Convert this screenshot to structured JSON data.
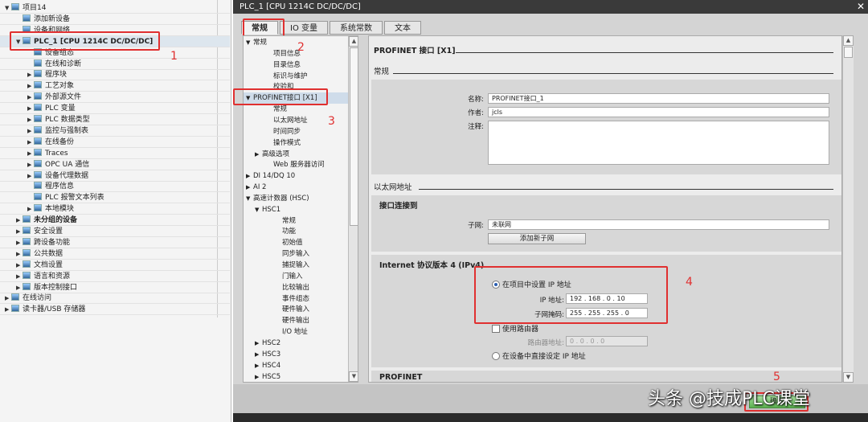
{
  "project_tree": {
    "items": [
      {
        "label": "项目14",
        "level": 0,
        "arrow": "▼"
      },
      {
        "label": "添加新设备",
        "level": 1,
        "arrow": ""
      },
      {
        "label": "设备和网络",
        "level": 1,
        "arrow": ""
      },
      {
        "label": "PLC_1 [CPU 1214C DC/DC/DC]",
        "level": 1,
        "arrow": "▼",
        "bold": true
      },
      {
        "label": "设备组态",
        "level": 2,
        "arrow": ""
      },
      {
        "label": "在线和诊断",
        "level": 2,
        "arrow": ""
      },
      {
        "label": "程序块",
        "level": 2,
        "arrow": "▶"
      },
      {
        "label": "工艺对象",
        "level": 2,
        "arrow": "▶"
      },
      {
        "label": "外部源文件",
        "level": 2,
        "arrow": "▶"
      },
      {
        "label": "PLC 变量",
        "level": 2,
        "arrow": "▶"
      },
      {
        "label": "PLC 数据类型",
        "level": 2,
        "arrow": "▶"
      },
      {
        "label": "监控与强制表",
        "level": 2,
        "arrow": "▶"
      },
      {
        "label": "在线备份",
        "level": 2,
        "arrow": "▶"
      },
      {
        "label": "Traces",
        "level": 2,
        "arrow": "▶"
      },
      {
        "label": "OPC UA 通信",
        "level": 2,
        "arrow": "▶"
      },
      {
        "label": "设备代理数据",
        "level": 2,
        "arrow": "▶"
      },
      {
        "label": "程序信息",
        "level": 2,
        "arrow": ""
      },
      {
        "label": "PLC 报警文本列表",
        "level": 2,
        "arrow": ""
      },
      {
        "label": "本地模块",
        "level": 2,
        "arrow": "▶"
      },
      {
        "label": "未分组的设备",
        "level": 1,
        "arrow": "▶",
        "bold": true
      },
      {
        "label": "安全设置",
        "level": 1,
        "arrow": "▶"
      },
      {
        "label": "跨设备功能",
        "level": 1,
        "arrow": "▶"
      },
      {
        "label": "公共数据",
        "level": 1,
        "arrow": "▶"
      },
      {
        "label": "文档设置",
        "level": 1,
        "arrow": "▶"
      },
      {
        "label": "语言和资源",
        "level": 1,
        "arrow": "▶"
      },
      {
        "label": "版本控制接口",
        "level": 1,
        "arrow": "▶"
      },
      {
        "label": "在线访问",
        "level": 0,
        "arrow": "▶"
      },
      {
        "label": "读卡器/USB 存储器",
        "level": 0,
        "arrow": "▶"
      }
    ]
  },
  "annotations": [
    "1",
    "2",
    "3",
    "4",
    "5"
  ],
  "dialog": {
    "title": "PLC_1 [CPU 1214C DC/DC/DC]",
    "close": "✕",
    "tabs": [
      "常规",
      "IO 变量",
      "系统常数",
      "文本"
    ],
    "nav": [
      {
        "label": "常规",
        "level": 0,
        "arrow": "▼"
      },
      {
        "label": "项目信息",
        "level": 1,
        "arrow": ""
      },
      {
        "label": "目录信息",
        "level": 1,
        "arrow": ""
      },
      {
        "label": "标识与维护",
        "level": 1,
        "arrow": ""
      },
      {
        "label": "校验和",
        "level": 1,
        "arrow": ""
      },
      {
        "label": "PROFINET接口 [X1]",
        "level": 0,
        "arrow": "▼",
        "sel": true
      },
      {
        "label": "常规",
        "level": 1,
        "arrow": ""
      },
      {
        "label": "以太网地址",
        "level": 1,
        "arrow": ""
      },
      {
        "label": "时间同步",
        "level": 1,
        "arrow": ""
      },
      {
        "label": "操作模式",
        "level": 1,
        "arrow": ""
      },
      {
        "label": "高级选项",
        "level": 1,
        "arrow": "▶"
      },
      {
        "label": "Web 服务器访问",
        "level": 1,
        "arrow": ""
      },
      {
        "label": "DI 14/DQ 10",
        "level": 0,
        "arrow": "▶"
      },
      {
        "label": "AI 2",
        "level": 0,
        "arrow": "▶"
      },
      {
        "label": "高速计数器 (HSC)",
        "level": 0,
        "arrow": "▼"
      },
      {
        "label": "HSC1",
        "level": 1,
        "arrow": "▼"
      },
      {
        "label": "常规",
        "level": 2,
        "arrow": ""
      },
      {
        "label": "功能",
        "level": 2,
        "arrow": ""
      },
      {
        "label": "初始值",
        "level": 2,
        "arrow": ""
      },
      {
        "label": "同步输入",
        "level": 2,
        "arrow": ""
      },
      {
        "label": "捕捉输入",
        "level": 2,
        "arrow": ""
      },
      {
        "label": "门输入",
        "level": 2,
        "arrow": ""
      },
      {
        "label": "比较输出",
        "level": 2,
        "arrow": ""
      },
      {
        "label": "事件组态",
        "level": 2,
        "arrow": ""
      },
      {
        "label": "硬件输入",
        "level": 2,
        "arrow": ""
      },
      {
        "label": "硬件输出",
        "level": 2,
        "arrow": ""
      },
      {
        "label": "I/O 地址",
        "level": 2,
        "arrow": ""
      },
      {
        "label": "HSC2",
        "level": 1,
        "arrow": "▶"
      },
      {
        "label": "HSC3",
        "level": 1,
        "arrow": "▶"
      },
      {
        "label": "HSC4",
        "level": 1,
        "arrow": "▶"
      },
      {
        "label": "HSC5",
        "level": 1,
        "arrow": "▶"
      }
    ],
    "content": {
      "heading": "PROFINET 接口 [X1]",
      "general": {
        "title": "常规",
        "name_label": "名称:",
        "name_value": "PROFINET接口_1",
        "author_label": "作者:",
        "author_value": "jcls",
        "comment_label": "注释:",
        "comment_value": ""
      },
      "ethernet": {
        "title": "以太网地址",
        "connect_title": "接口连接到",
        "subnet_label": "子网:",
        "subnet_value": "未联网",
        "add_subnet": "添加新子网"
      },
      "ipv4": {
        "title": "Internet 协议版本 4 (IPv4)",
        "opt_project": "在项目中设置 IP 地址",
        "ip_label": "IP 地址:",
        "ip_value": "192 . 168 . 0    . 10",
        "mask_label": "子网掩码:",
        "mask_value": "255 . 255 . 255 . 0",
        "use_router": "使用路由器",
        "router_label": "路由器地址:",
        "router_value": "0    . 0    . 0    . 0",
        "opt_device": "在设备中直接设定 IP 地址"
      },
      "profinet_title": "PROFINET"
    },
    "ok": "确定"
  },
  "watermark": "头条 @技成PLC课堂"
}
